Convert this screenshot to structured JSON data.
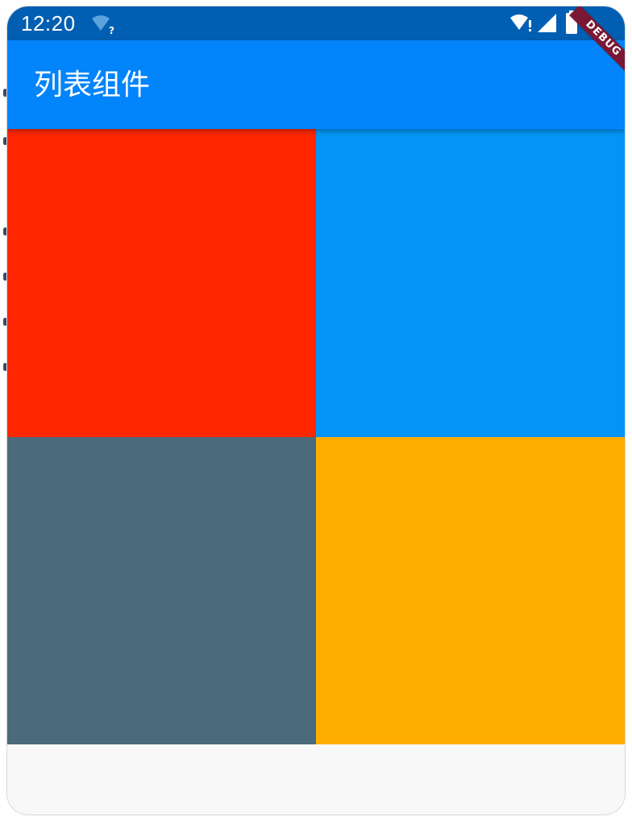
{
  "status_bar": {
    "time": "12:20",
    "icons": [
      "wifi-unknown-icon",
      "wifi-alert-icon",
      "cell-signal-icon",
      "battery-icon"
    ]
  },
  "app_bar": {
    "title": "列表组件"
  },
  "debug_banner": {
    "label": "DEBUG"
  },
  "grid": {
    "tiles": [
      {
        "name": "red-tile",
        "color": "#ff2600"
      },
      {
        "name": "blue-tile",
        "color": "#0395f5"
      },
      {
        "name": "blue-grey-tile",
        "color": "#4a6b7b"
      },
      {
        "name": "amber-tile",
        "color": "#ffae00"
      }
    ]
  },
  "colors": {
    "status_bar": "#005fb2",
    "app_bar": "#0284fb",
    "background": "#f8f8f8"
  }
}
